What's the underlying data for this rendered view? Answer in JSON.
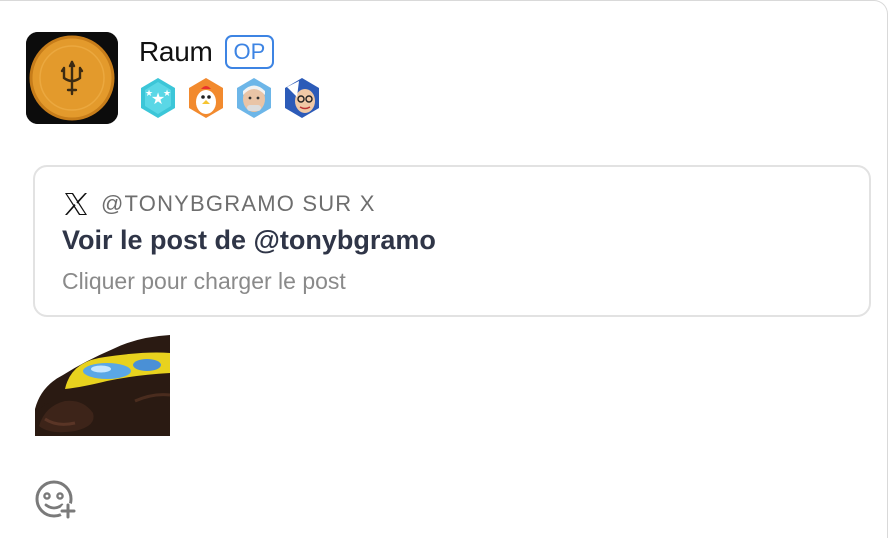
{
  "post": {
    "username": "Raum",
    "op_badge": "OP",
    "avatar_icon": "trident-coin-avatar",
    "flairs": [
      "star-medal-flair",
      "chicken-flair",
      "old-man-flair",
      "wizard-flair"
    ]
  },
  "embed": {
    "source_icon": "x-logo-icon",
    "source_label": "@TONYBGRAMO SUR X",
    "title": "Voir le post de @tonybgramo",
    "subtitle": "Cliquer pour charger le post"
  },
  "sticker": {
    "icon": "sunglasses-man-sticker"
  },
  "actions": {
    "add_reaction_icon": "add-reaction-icon"
  },
  "colors": {
    "op_badge": "#3d84e3",
    "title": "#2f3547",
    "muted": "#8a8a8a",
    "card_border": "#e2e2e2"
  }
}
